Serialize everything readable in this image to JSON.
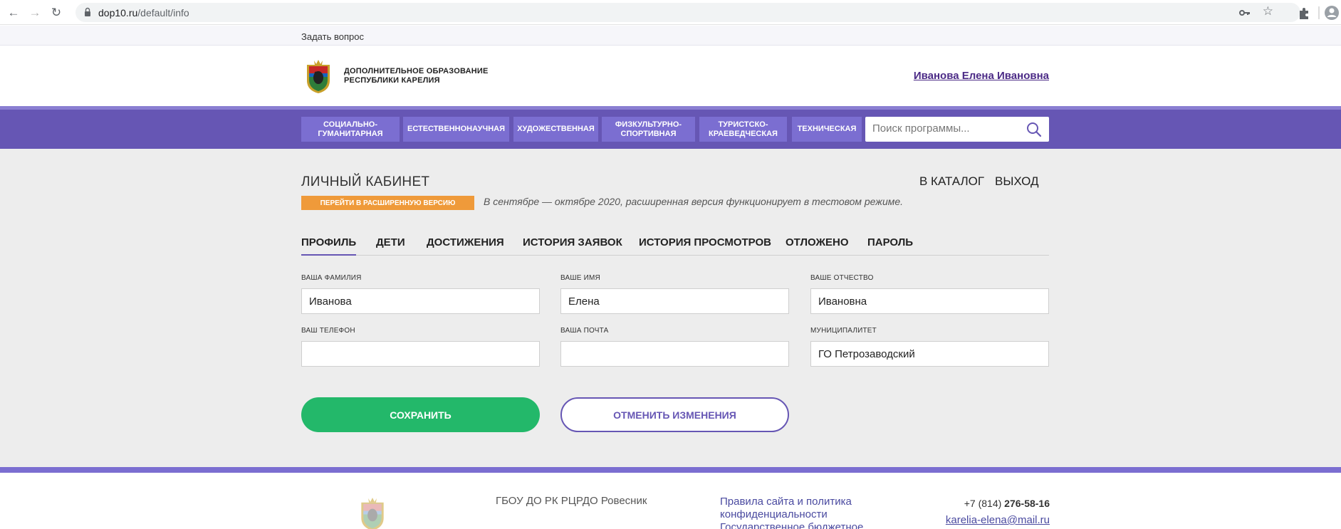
{
  "browser": {
    "url_host": "dop10.ru",
    "url_path": "/default/info"
  },
  "topbar": {
    "ask_question": "Задать вопрос"
  },
  "header": {
    "logo_line1": "ДОПОЛНИТЕЛЬНОЕ ОБРАЗОВАНИЕ",
    "logo_line2": "РЕСПУБЛИКИ КАРЕЛИЯ",
    "user_name": "Иванова Елена Ивановна"
  },
  "categories": [
    {
      "line1": "СОЦИАЛЬНО-",
      "line2": "ГУМАНИТАРНАЯ"
    },
    {
      "line1": "ЕСТЕСТВЕННОНАУЧНАЯ",
      "line2": ""
    },
    {
      "line1": "ХУДОЖЕСТВЕННАЯ",
      "line2": ""
    },
    {
      "line1": "ФИЗКУЛЬТУРНО-",
      "line2": "СПОРТИВНАЯ"
    },
    {
      "line1": "ТУРИСТСКО-",
      "line2": "КРАЕВЕДЧЕСКАЯ"
    },
    {
      "line1": "ТЕХНИЧЕСКАЯ",
      "line2": ""
    }
  ],
  "search": {
    "placeholder": "Поиск программы..."
  },
  "cabinet": {
    "title": "ЛИЧНЫЙ КАБИНЕТ",
    "catalog_link": "В КАТАЛОГ",
    "logout_link": "ВЫХОД",
    "extended_button": "ПЕРЕЙТИ В РАСШИРЕННУЮ ВЕРСИЮ",
    "extended_note": "В сентябре — октябре 2020, расширенная версия функционирует в тестовом режиме."
  },
  "tabs": [
    {
      "label": "ПРОФИЛЬ",
      "active": true
    },
    {
      "label": "ДЕТИ",
      "active": false
    },
    {
      "label": "ДОСТИЖЕНИЯ",
      "active": false
    },
    {
      "label": "ИСТОРИЯ ЗАЯВОК",
      "active": false
    },
    {
      "label": "ИСТОРИЯ ПРОСМОТРОВ",
      "active": false
    },
    {
      "label": "ОТЛОЖЕНО",
      "active": false
    },
    {
      "label": "ПАРОЛЬ",
      "active": false
    }
  ],
  "form": {
    "surname_label": "ВАША ФАМИЛИЯ",
    "surname_value": "Иванова",
    "name_label": "ВАШЕ ИМЯ",
    "name_value": "Елена",
    "patronymic_label": "ВАШЕ ОТЧЕСТВО",
    "patronymic_value": "Ивановна",
    "phone_label": "ВАШ ТЕЛЕФОН",
    "phone_value": "",
    "email_label": "ВАША ПОЧТА",
    "email_value": "",
    "municipality_label": "МУНИЦИПАЛИТЕТ",
    "municipality_value": "ГО Петрозаводский",
    "save_button": "СОХРАНИТЬ",
    "cancel_button": "ОТМЕНИТЬ ИЗМЕНЕНИЯ"
  },
  "footer": {
    "org": "ГБОУ ДО РК РЦРДО Ровесник",
    "rules_line1": "Правила сайта и политика",
    "rules_line2": "конфиденциальности",
    "rules_line3": "Государственное бюджетное",
    "phone_prefix": "+7 (814)",
    "phone_number": "276-58-16",
    "email": "karelia-elena@mail.ru"
  },
  "colors": {
    "brand_purple": "#6656b4",
    "save_green": "#23b86a",
    "extended_orange": "#ef9a3a",
    "user_link": "#4b2a86"
  }
}
